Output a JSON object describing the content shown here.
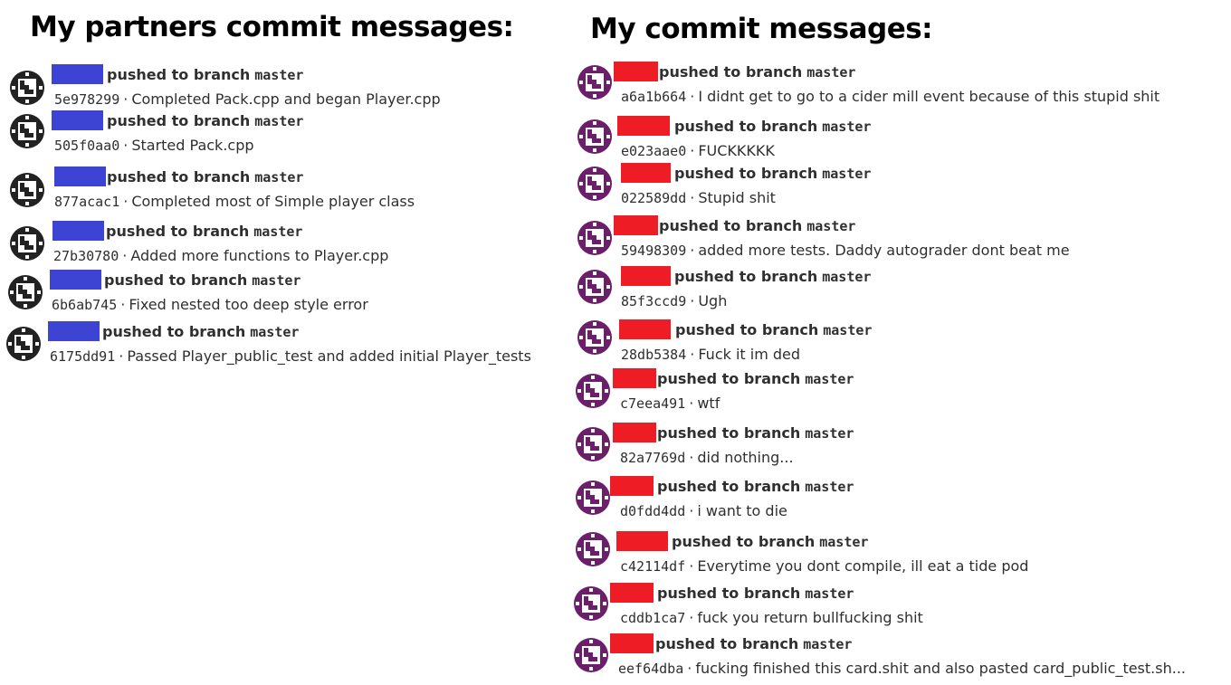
{
  "left_panel": {
    "title": "My partners commit messages:",
    "name_color": "#3d44d4",
    "avatar_color": "#222222",
    "commits": [
      {
        "action": "pushed to branch",
        "branch": "master",
        "sha": "5e978299",
        "message": "Completed Pack.cpp and began Player.cpp"
      },
      {
        "action": "pushed to branch",
        "branch": "master",
        "sha": "505f0aa0",
        "message": "Started Pack.cpp"
      },
      {
        "action": "pushed to branch",
        "branch": "master",
        "sha": "877acac1",
        "message": "Completed most of Simple player class"
      },
      {
        "action": "pushed to branch",
        "branch": "master",
        "sha": "27b30780",
        "message": "Added more functions to Player.cpp"
      },
      {
        "action": "pushed to branch",
        "branch": "master",
        "sha": "6b6ab745",
        "message": "Fixed nested too deep style error"
      },
      {
        "action": "pushed to branch",
        "branch": "master",
        "sha": "6175dd91",
        "message": "Passed Player_public_test and added initial Player_tests"
      }
    ]
  },
  "right_panel": {
    "title": "My commit messages:",
    "name_color": "#ee1c24",
    "avatar_color": "#6b1f6b",
    "commits": [
      {
        "action": "pushed to branch",
        "branch": "master",
        "sha": "a6a1b664",
        "message": "I didnt get to go to a cider mill event because of this stupid shit"
      },
      {
        "action": "pushed to branch",
        "branch": "master",
        "sha": "e023aae0",
        "message": "FUCKKKKK"
      },
      {
        "action": "pushed to branch",
        "branch": "master",
        "sha": "022589dd",
        "message": "Stupid shit"
      },
      {
        "action": "pushed to branch",
        "branch": "master",
        "sha": "59498309",
        "message": "added more tests. Daddy autograder dont beat me"
      },
      {
        "action": "pushed to branch",
        "branch": "master",
        "sha": "85f3ccd9",
        "message": "Ugh"
      },
      {
        "action": "pushed to branch",
        "branch": "master",
        "sha": "28db5384",
        "message": "Fuck it im ded"
      },
      {
        "action": "pushed to branch",
        "branch": "master",
        "sha": "c7eea491",
        "message": "wtf"
      },
      {
        "action": "pushed to branch",
        "branch": "master",
        "sha": "82a7769d",
        "message": "did nothing..."
      },
      {
        "action": "pushed to branch",
        "branch": "master",
        "sha": "d0fdd4dd",
        "message": "i want to die"
      },
      {
        "action": "pushed to branch",
        "branch": "master",
        "sha": "c42114df",
        "message": "Everytime you dont compile, ill eat a tide pod"
      },
      {
        "action": "pushed to branch",
        "branch": "master",
        "sha": "cddb1ca7",
        "message": "fuck you return bullfucking shit"
      },
      {
        "action": "pushed to branch",
        "branch": "master",
        "sha": "eef64dba",
        "message": "fucking finished this card.shit and also pasted card_public_test.sh..."
      }
    ]
  },
  "separator": "·"
}
